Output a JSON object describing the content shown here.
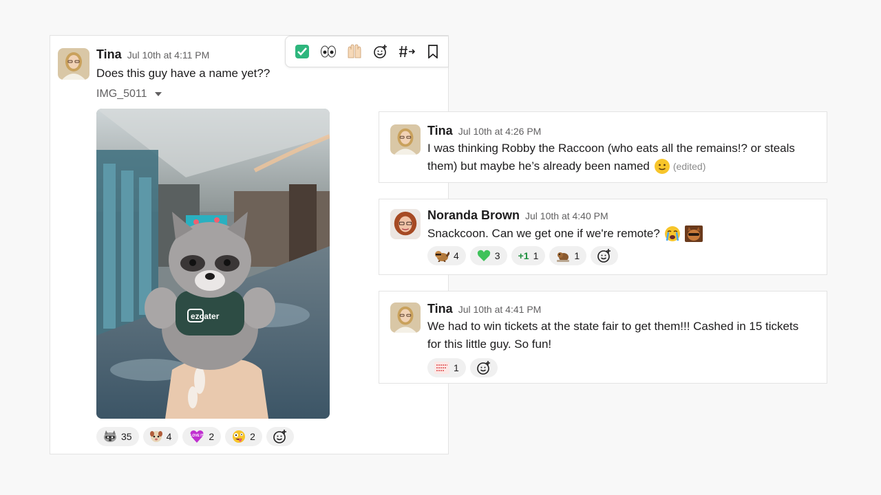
{
  "main_message": {
    "author": "Tina",
    "timestamp": "Jul 10th at 4:11 PM",
    "text": "Does this guy have a name yet??",
    "file_name": "IMG_5011",
    "shirt_text": "ezcater",
    "reactions": [
      {
        "icon": "raccoon-emoji",
        "count": "35"
      },
      {
        "icon": "dog-emoji",
        "count": "4"
      },
      {
        "icon": "love-it-emoji",
        "label": "LOVE IT",
        "count": "2"
      },
      {
        "icon": "crazy-face-emoji",
        "count": "2"
      }
    ],
    "toolbar": [
      "check-mark-icon",
      "eyes-icon",
      "raised-hands-icon",
      "add-reaction-icon",
      "share-channel-icon",
      "bookmark-icon"
    ]
  },
  "replies": [
    {
      "author": "Tina",
      "timestamp": "Jul 10th at 4:26 PM",
      "text_line1": "I was thinking Robby the Raccoon (who eats all the remains!? or steals",
      "text_line2": "them) but maybe he’s already been named",
      "edited": "(edited)"
    },
    {
      "author": "Noranda Brown",
      "timestamp": "Jul 10th at 4:40 PM",
      "text": "Snackcoon. Can we get one if we're remote?",
      "reactions": [
        {
          "icon": "raccoon-running-emoji",
          "count": "4"
        },
        {
          "icon": "green-heart-emoji",
          "count": "3"
        },
        {
          "icon": "plus-one-emoji",
          "label": "+1",
          "count": "1"
        },
        {
          "icon": "beaver-emoji",
          "count": "1"
        }
      ]
    },
    {
      "author": "Tina",
      "timestamp": "Jul 10th at 4:41 PM",
      "text_line1": "We had to win tickets at the state fair to get them!!! Cashed in 15 tickets",
      "text_line2": "for this little guy. So fun!",
      "reactions": [
        {
          "icon": "text-sticker-emoji",
          "count": "1"
        }
      ]
    }
  ],
  "colors": {
    "name": "#1d1c1d",
    "time": "#616061",
    "pill": "#f0f0f0",
    "check": "#2eb67d"
  }
}
